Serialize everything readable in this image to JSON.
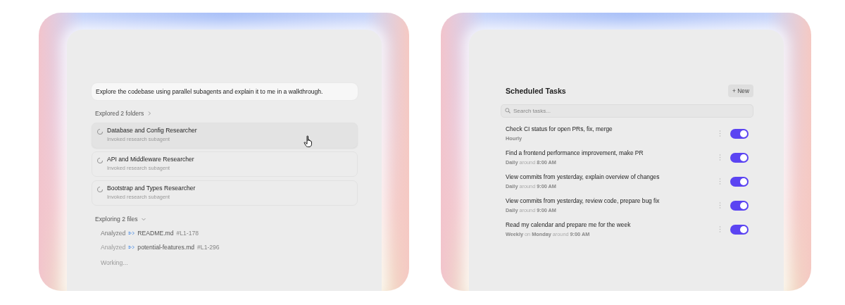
{
  "agent_panel": {
    "prompt": "Explore the codebase using parallel subagents and explain it to me in a walkthrough.",
    "explored": {
      "label": "Explored 2 folders",
      "expanded": false
    },
    "subagents": [
      {
        "name": "Database and Config Researcher",
        "detail": "Invoked research subagent",
        "highlighted": true
      },
      {
        "name": "API and Middleware Researcher",
        "detail": "Invoked research subagent",
        "highlighted": false
      },
      {
        "name": "Bootstrap and Types Researcher",
        "detail": "Invoked research subagent",
        "highlighted": false
      }
    ],
    "exploring": {
      "label": "Exploring 2 files",
      "expanded": true
    },
    "files": [
      {
        "kind": "analyzed",
        "verb": "Analyzed",
        "file": "README.md",
        "range": "#L1-178",
        "faded": false
      },
      {
        "kind": "analyzed",
        "verb": "Analyzed",
        "file": "potential-features.md",
        "range": "#L1-296",
        "faded": true
      },
      {
        "kind": "status",
        "verb": "Working...",
        "faded": true
      }
    ]
  },
  "tasks_panel": {
    "title": "Scheduled Tasks",
    "new_button": "+ New",
    "search": {
      "placeholder": "Search tasks..."
    },
    "tasks": [
      {
        "name": "Check CI status for open PRs, fix, merge",
        "schedule": "**Hourly**",
        "on": true
      },
      {
        "name": "Find a frontend performance improvement, make PR",
        "schedule": "**Daily** around **8:00 AM**",
        "on": true
      },
      {
        "name": "View commits from yesterday, explain overview of changes",
        "schedule": "**Daily** around **9:00 AM**",
        "on": true
      },
      {
        "name": "View commits from yesterday, review code, prepare bug fix",
        "schedule": "**Daily** around **9:00 AM**",
        "on": true
      },
      {
        "name": "Read my calendar and prepare me for the week",
        "schedule": "**Weekly** on **Monday** around **9:00 AM**",
        "on": true
      }
    ]
  }
}
